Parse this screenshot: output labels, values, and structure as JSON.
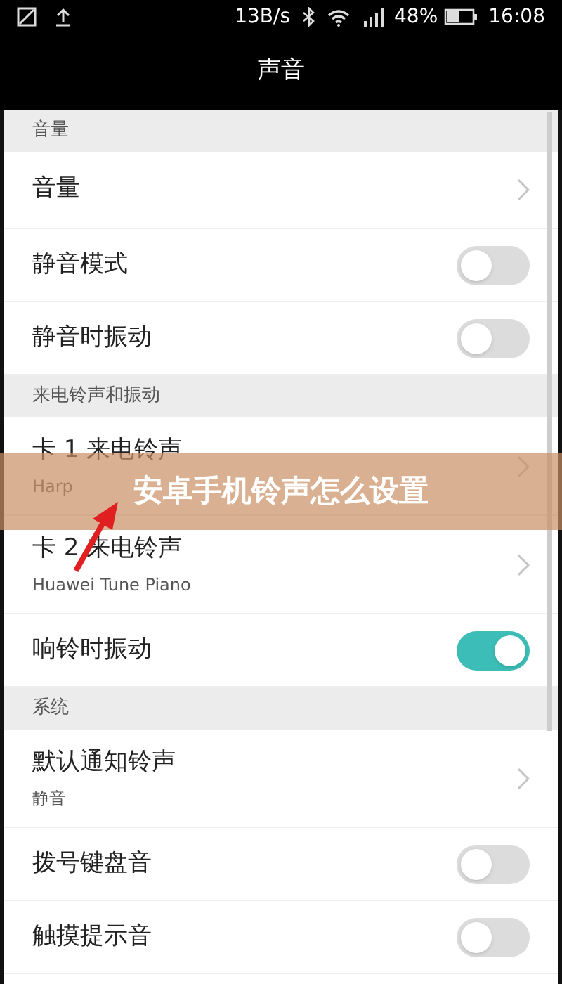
{
  "status_bar": {
    "speed": "13B/s",
    "battery": "48%",
    "time": "16:08"
  },
  "title": "声音",
  "items": [
    {
      "kind": "header",
      "label": "音量"
    },
    {
      "kind": "nav",
      "label": "音量"
    },
    {
      "kind": "toggle",
      "label": "静音模式",
      "on": false
    },
    {
      "kind": "toggle",
      "label": "静音时振动",
      "on": false
    },
    {
      "kind": "header",
      "label": "来电铃声和振动"
    },
    {
      "kind": "nav",
      "label": "卡 1 来电铃声",
      "subtitle": "Harp"
    },
    {
      "kind": "nav",
      "label": "卡 2 来电铃声",
      "subtitle": "Huawei Tune Piano"
    },
    {
      "kind": "toggle",
      "label": "响铃时振动",
      "on": true
    },
    {
      "kind": "header",
      "label": "系统"
    },
    {
      "kind": "nav",
      "label": "默认通知铃声",
      "subtitle": "静音"
    },
    {
      "kind": "toggle",
      "label": "拨号键盘音",
      "on": false
    },
    {
      "kind": "toggle",
      "label": "触摸提示音",
      "on": false
    }
  ],
  "banner": {
    "text": "安卓手机铃声怎么设置"
  }
}
